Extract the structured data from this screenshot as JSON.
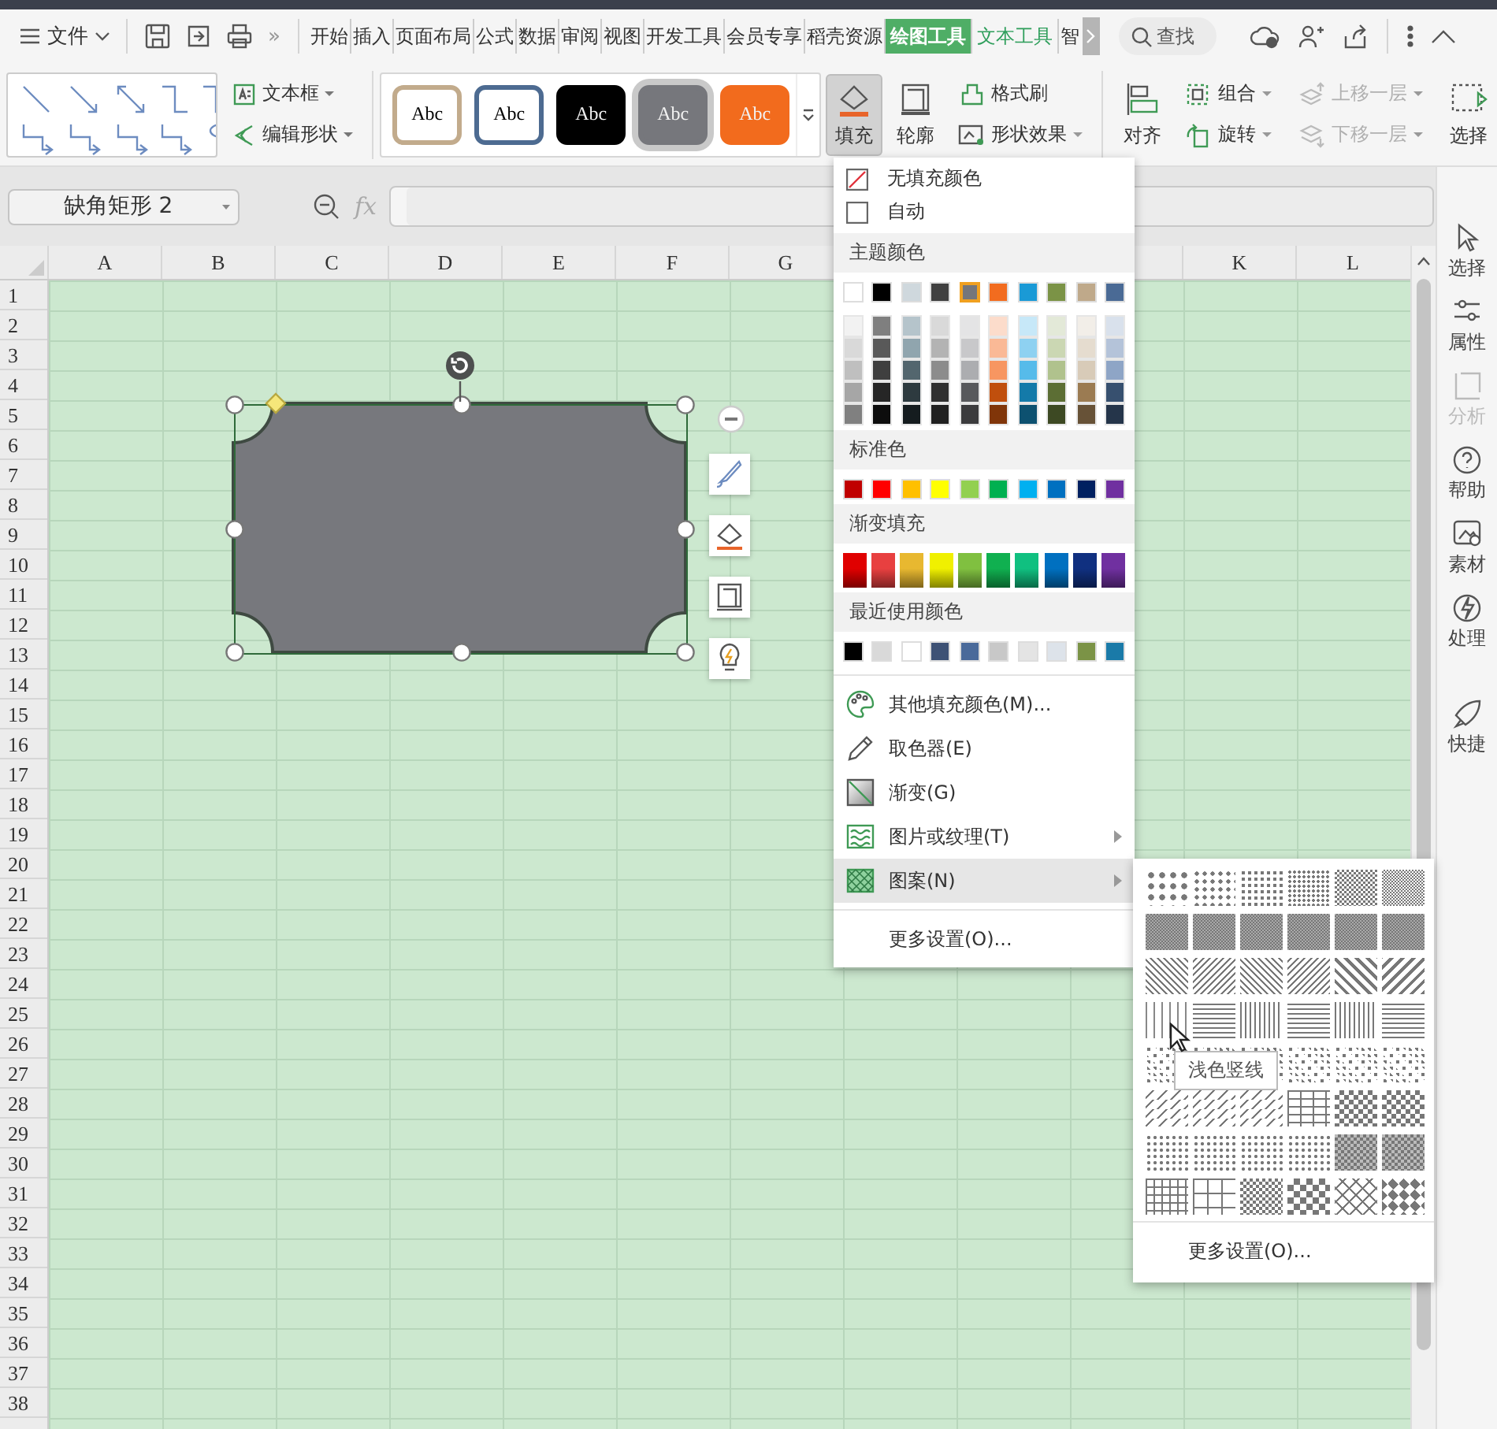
{
  "menu_bar": {
    "file_menu": "文件",
    "overflow": "»",
    "tabs": [
      {
        "label": "开始",
        "selected": false,
        "contextual": false
      },
      {
        "label": "插入",
        "selected": false,
        "contextual": false
      },
      {
        "label": "页面布局",
        "selected": false,
        "contextual": false
      },
      {
        "label": "公式",
        "selected": false,
        "contextual": false
      },
      {
        "label": "数据",
        "selected": false,
        "contextual": false
      },
      {
        "label": "审阅",
        "selected": false,
        "contextual": false
      },
      {
        "label": "视图",
        "selected": false,
        "contextual": false
      },
      {
        "label": "开发工具",
        "selected": false,
        "contextual": false
      },
      {
        "label": "会员专享",
        "selected": false,
        "contextual": false
      },
      {
        "label": "稻壳资源",
        "selected": false,
        "contextual": false
      },
      {
        "label": "绘图工具",
        "selected": true,
        "contextual": true
      },
      {
        "label": "文本工具",
        "selected": false,
        "contextual": true
      },
      {
        "label": "智",
        "selected": false,
        "contextual": false
      }
    ],
    "search": {
      "placeholder": "查找"
    }
  },
  "ribbon": {
    "text_box": {
      "label": "文本框"
    },
    "edit_shape": {
      "label": "编辑形状"
    },
    "style_presets": [
      {
        "label": "Abc",
        "kind": "outline",
        "color": "#c2ab8c",
        "selected": false
      },
      {
        "label": "Abc",
        "kind": "outline",
        "color": "#4d6b91",
        "selected": false
      },
      {
        "label": "Abc",
        "kind": "filled",
        "color": "#000000",
        "selected": false
      },
      {
        "label": "Abc",
        "kind": "filled",
        "color": "#76777c",
        "selected": true
      },
      {
        "label": "Abc",
        "kind": "filled",
        "color": "#f26b1d",
        "selected": false
      }
    ],
    "fill": {
      "label": "填充",
      "active": true
    },
    "outline": {
      "label": "轮廓"
    },
    "format_painter": {
      "label": "格式刷"
    },
    "shape_effects": {
      "label": "形状效果"
    },
    "align": {
      "label": "对齐"
    },
    "group": {
      "label": "组合"
    },
    "rotate": {
      "label": "旋转"
    },
    "bring_forward": {
      "label": "上移一层",
      "disabled": true
    },
    "send_backward": {
      "label": "下移一层",
      "disabled": true
    },
    "selection": {
      "label": "选择"
    }
  },
  "formula_bar": {
    "name_box": "缺角矩形 2",
    "fx": "fx"
  },
  "sheet": {
    "columns_left": [
      "A",
      "B",
      "C",
      "D",
      "E",
      "F",
      "G"
    ],
    "columns_right": [
      "K",
      "L"
    ],
    "rows": [
      "1",
      "2",
      "3",
      "4",
      "5",
      "6",
      "7",
      "8",
      "9",
      "10",
      "11",
      "12",
      "13",
      "14",
      "15",
      "16",
      "17",
      "18",
      "19",
      "20",
      "21",
      "22",
      "23",
      "24",
      "25",
      "26",
      "27",
      "28",
      "29",
      "30",
      "31",
      "32",
      "33",
      "34",
      "35",
      "36",
      "37",
      "38"
    ]
  },
  "fill_menu": {
    "options": [
      {
        "label": "无填充颜色",
        "kind": "none"
      },
      {
        "label": "自动",
        "kind": "auto"
      }
    ],
    "theme": {
      "title": "主题颜色",
      "colors": [
        {
          "color": "#ffffff",
          "selected": false
        },
        {
          "color": "#000000",
          "selected": false
        },
        {
          "color": "#cfd8dd",
          "selected": false
        },
        {
          "color": "#404040",
          "selected": false
        },
        {
          "color": "#75767b",
          "selected": true
        },
        {
          "color": "#f26c1f",
          "selected": false
        },
        {
          "color": "#1a9ad6",
          "selected": false
        },
        {
          "color": "#7b9346",
          "selected": false
        },
        {
          "color": "#bfa98a",
          "selected": false
        },
        {
          "color": "#4a6a95",
          "selected": false
        }
      ],
      "shades": [
        [
          {
            "color": "#f2f2f2"
          },
          {
            "color": "#7f7f7f"
          },
          {
            "color": "#b5c4cb"
          },
          {
            "color": "#d9d9d9"
          },
          {
            "color": "#e4e4e5"
          },
          {
            "color": "#fcdccb"
          },
          {
            "color": "#c7e8f8"
          },
          {
            "color": "#e3e9d8"
          },
          {
            "color": "#f2eee8"
          },
          {
            "color": "#d9e1ec"
          }
        ],
        [
          {
            "color": "#d9d9d9"
          },
          {
            "color": "#595959"
          },
          {
            "color": "#90a5ae"
          },
          {
            "color": "#b3b3b3"
          },
          {
            "color": "#c8c8ca"
          },
          {
            "color": "#fab996"
          },
          {
            "color": "#8ed1f1"
          },
          {
            "color": "#cbd7b3"
          },
          {
            "color": "#e5dccf"
          },
          {
            "color": "#b4c3d9"
          }
        ],
        [
          {
            "color": "#bfbfbf"
          },
          {
            "color": "#3f3f3f"
          },
          {
            "color": "#53666e"
          },
          {
            "color": "#8c8c8c"
          },
          {
            "color": "#acadb0"
          },
          {
            "color": "#f79661"
          },
          {
            "color": "#56bbea"
          },
          {
            "color": "#b0c28d"
          },
          {
            "color": "#d8cbb8"
          },
          {
            "color": "#8ea5c6"
          }
        ],
        [
          {
            "color": "#a6a6a6"
          },
          {
            "color": "#262626"
          },
          {
            "color": "#2d3a3f"
          },
          {
            "color": "#303030"
          },
          {
            "color": "#58595c"
          },
          {
            "color": "#c04f0d"
          },
          {
            "color": "#147aa9"
          },
          {
            "color": "#5c6e34"
          },
          {
            "color": "#9b7b52"
          },
          {
            "color": "#37506f"
          }
        ],
        [
          {
            "color": "#808080"
          },
          {
            "color": "#0d0d0d"
          },
          {
            "color": "#151c1f"
          },
          {
            "color": "#202020"
          },
          {
            "color": "#3b3b3d"
          },
          {
            "color": "#803509"
          },
          {
            "color": "#0d5170"
          },
          {
            "color": "#3d4923"
          },
          {
            "color": "#675237"
          },
          {
            "color": "#25354a"
          }
        ]
      ]
    },
    "standard": {
      "title": "标准色",
      "colors": [
        {
          "color": "#c00000"
        },
        {
          "color": "#ff0000"
        },
        {
          "color": "#ffc000"
        },
        {
          "color": "#ffff00"
        },
        {
          "color": "#92d050"
        },
        {
          "color": "#00b050"
        },
        {
          "color": "#00b0f0"
        },
        {
          "color": "#0070c0"
        },
        {
          "color": "#002060"
        },
        {
          "color": "#7030a0"
        }
      ]
    },
    "gradient": {
      "title": "渐变填充",
      "colors": [
        {
          "color": "#e00000"
        },
        {
          "color": "#e84040"
        },
        {
          "color": "#e8b830"
        },
        {
          "color": "#f0f000"
        },
        {
          "color": "#80c040"
        },
        {
          "color": "#10b050"
        },
        {
          "color": "#10c080"
        },
        {
          "color": "#0070c0"
        },
        {
          "color": "#103080"
        },
        {
          "color": "#7030a0"
        }
      ]
    },
    "recent": {
      "title": "最近使用颜色",
      "colors": [
        {
          "color": "#000000"
        },
        {
          "color": "#d9d9d9"
        },
        {
          "color": "#ffffff"
        },
        {
          "color": "#3e5275"
        },
        {
          "color": "#4a6a9a"
        },
        {
          "color": "#c8c8c8"
        },
        {
          "color": "#e4e4e4"
        },
        {
          "color": "#dde3ea"
        },
        {
          "color": "#7b9346"
        },
        {
          "color": "#1a7aa8"
        }
      ]
    },
    "commands": [
      {
        "label": "其他填充颜色(M)...",
        "kind": "palette",
        "submenu": false,
        "highlighted": false
      },
      {
        "label": "取色器(E)",
        "kind": "eyedropper",
        "submenu": false,
        "highlighted": false
      },
      {
        "label": "渐变(G)",
        "kind": "gradient",
        "submenu": false,
        "highlighted": false
      },
      {
        "label": "图片或纹理(T)",
        "kind": "texture",
        "submenu": true,
        "highlighted": false
      },
      {
        "label": "图案(N)",
        "kind": "pattern",
        "submenu": true,
        "highlighted": true
      }
    ],
    "more": "更多设置(O)..."
  },
  "pattern_menu": {
    "tooltip": "浅色竖线",
    "more": "更多设置(O)..."
  },
  "side_panel": {
    "items": [
      {
        "label": "选择",
        "disabled": false
      },
      {
        "label": "属性",
        "disabled": false
      },
      {
        "label": "分析",
        "disabled": true
      },
      {
        "label": "帮助",
        "disabled": false
      },
      {
        "label": "素材",
        "disabled": false
      },
      {
        "label": "处理",
        "disabled": false
      },
      {
        "label": "快捷",
        "disabled": false
      }
    ]
  }
}
